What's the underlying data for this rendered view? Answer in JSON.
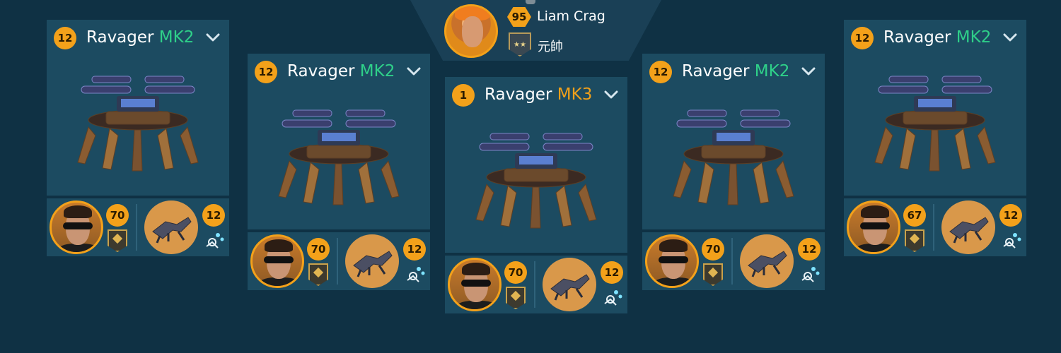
{
  "player": {
    "level": "95",
    "name": "Liam Crag",
    "rank": "元帥"
  },
  "robots": [
    {
      "level": "12",
      "name": "Ravager",
      "tier": "MK2",
      "pilot_level": "70",
      "drone_level": "12"
    },
    {
      "level": "12",
      "name": "Ravager",
      "tier": "MK2",
      "pilot_level": "70",
      "drone_level": "12"
    },
    {
      "level": "1",
      "name": "Ravager",
      "tier": "MK3",
      "pilot_level": "70",
      "drone_level": "12"
    },
    {
      "level": "12",
      "name": "Ravager",
      "tier": "MK2",
      "pilot_level": "70",
      "drone_level": "12"
    },
    {
      "level": "12",
      "name": "Ravager",
      "tier": "MK2",
      "pilot_level": "67",
      "drone_level": "12"
    }
  ],
  "colors": {
    "tier_mk2": "#2fd089",
    "tier_mk3": "#f0a01a",
    "badge": "#f3a11a",
    "panel": "#1c4b61",
    "background": "#0f3144"
  },
  "icons": [
    "chevron-down-icon",
    "rank-emblem-icon",
    "drone-ability-icon",
    "pilot-avatar",
    "drone-avatar",
    "robot-model"
  ]
}
